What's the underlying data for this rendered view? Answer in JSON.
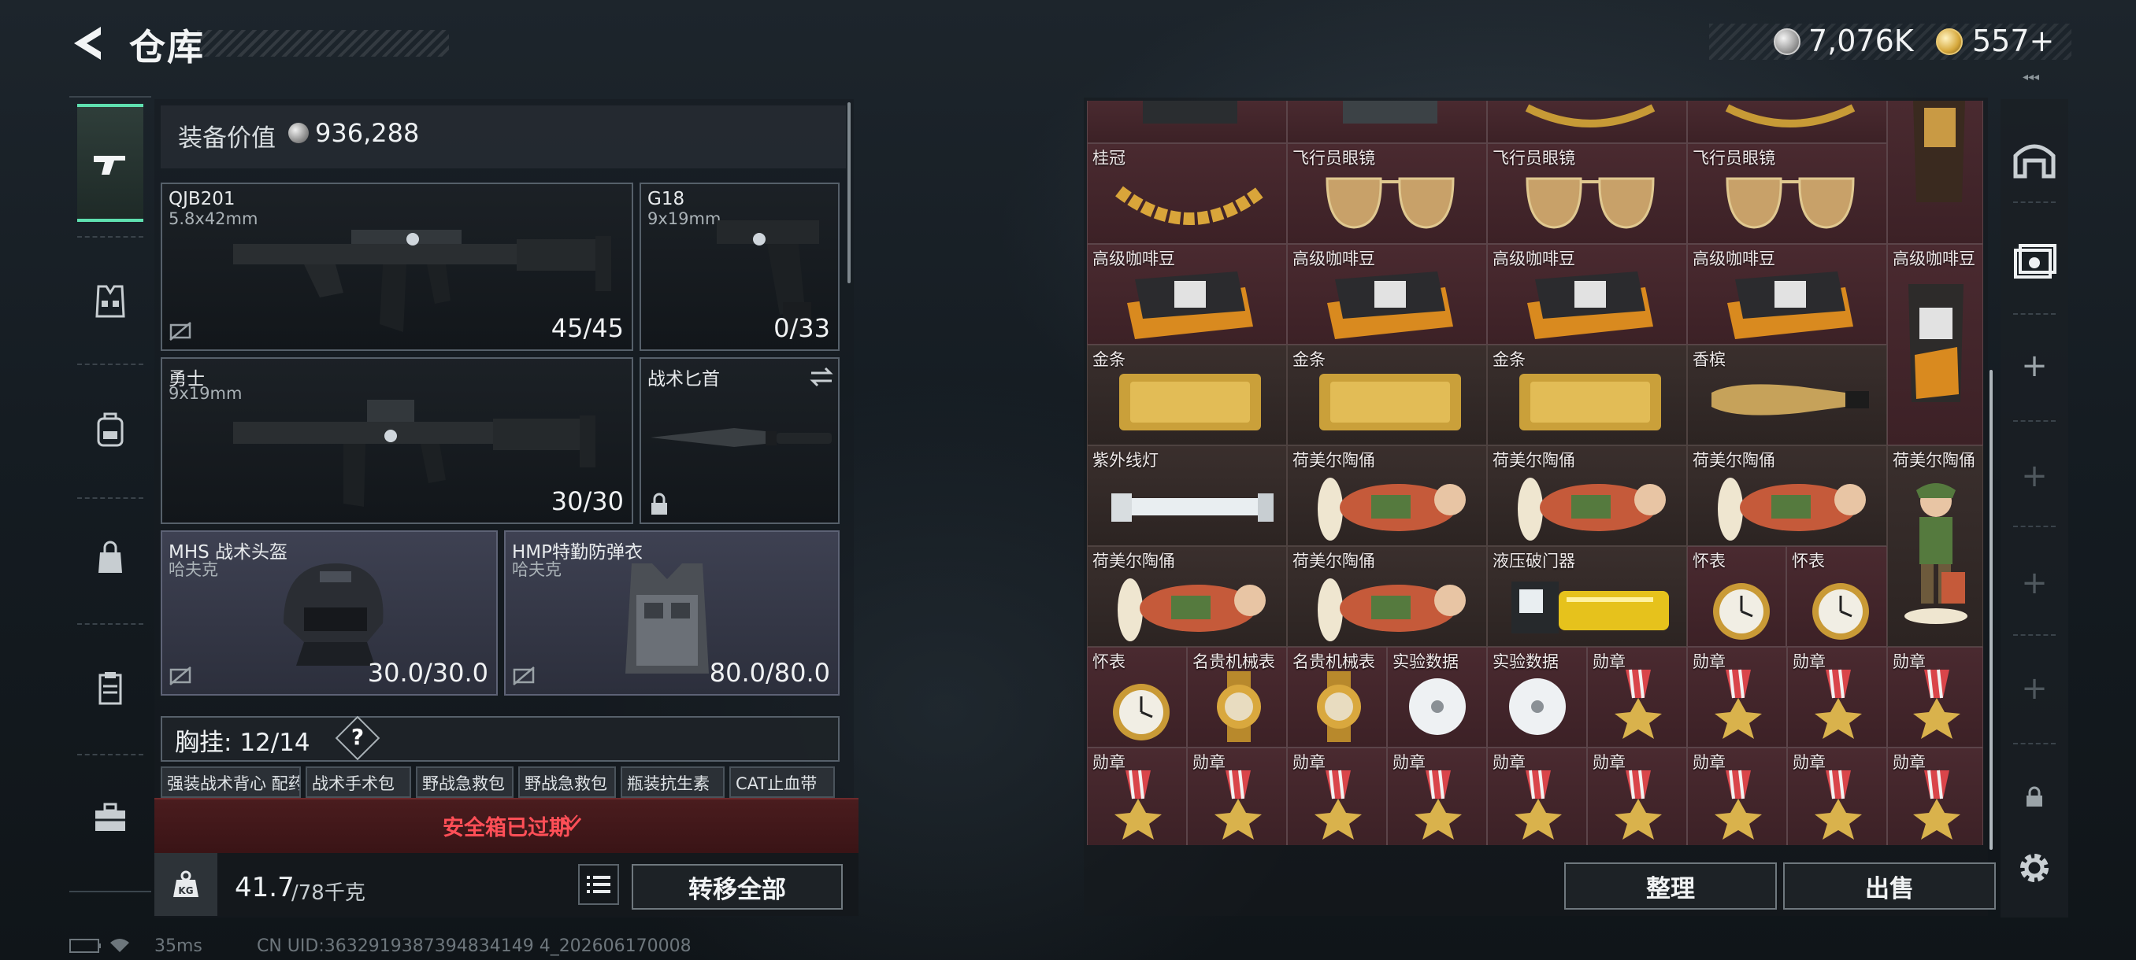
{
  "header": {
    "title": "仓库",
    "currency_silver": "7,076K",
    "currency_gold": "557+"
  },
  "sidebar": {
    "tabs": [
      {
        "icon": "pistol-icon",
        "active": true
      },
      {
        "icon": "vest-icon",
        "active": false
      },
      {
        "icon": "backpack-icon",
        "active": false
      },
      {
        "icon": "bag-icon",
        "active": false
      },
      {
        "icon": "clipboard-icon",
        "active": false
      },
      {
        "icon": "toolbox-icon",
        "active": false
      }
    ]
  },
  "loadout": {
    "value_label": "装备价值",
    "value": "936,288",
    "slots": {
      "primary": {
        "name": "QJB201",
        "caliber": "5.8x42mm",
        "ammo": "45/45"
      },
      "sidearm": {
        "name": "G18",
        "caliber": "9x19mm",
        "ammo": "0/33"
      },
      "secondary": {
        "name": "勇士",
        "caliber": "9x19mm",
        "ammo": "30/30"
      },
      "melee": {
        "name": "战术匕首"
      },
      "helmet": {
        "name": "MHS 战术头盔",
        "sub": "哈夫克",
        "durability": "30.0/30.0"
      },
      "armor": {
        "name": "HMP特勤防弹衣",
        "sub": "哈夫克",
        "durability": "80.0/80.0"
      }
    },
    "rig": {
      "label": "胸挂:",
      "count": "12/14",
      "help": "?",
      "pouches": [
        "强装战术背心\n配药包",
        "战术手术包",
        "野战急救包",
        "野战急救包",
        "瓶装抗生素",
        "CAT止血带"
      ]
    },
    "safebox_text": "安全箱已过期",
    "weight": "41.7",
    "weight_max": "/78千克",
    "transfer_all": "转移全部"
  },
  "status": {
    "ping": "35ms",
    "uid": "CN UID:3632919387394834149 4_202606170008"
  },
  "stash": {
    "top_row": [
      "",
      "",
      "",
      ""
    ],
    "labels": {
      "laurel": "桂冠",
      "aviator": "飞行员眼镜",
      "coffee": "高级咖啡豆",
      "gold": "金条",
      "champagne": "香槟",
      "uv_lamp": "紫外线灯",
      "figurine": "荷美尔陶俑",
      "breacher": "液压破门器",
      "pocket_watch": "怀表",
      "luxury_watch": "名贵机械表",
      "data_disc": "实验数据",
      "medal": "勋章"
    },
    "sort_label": "整理",
    "sell_label": "出售"
  }
}
